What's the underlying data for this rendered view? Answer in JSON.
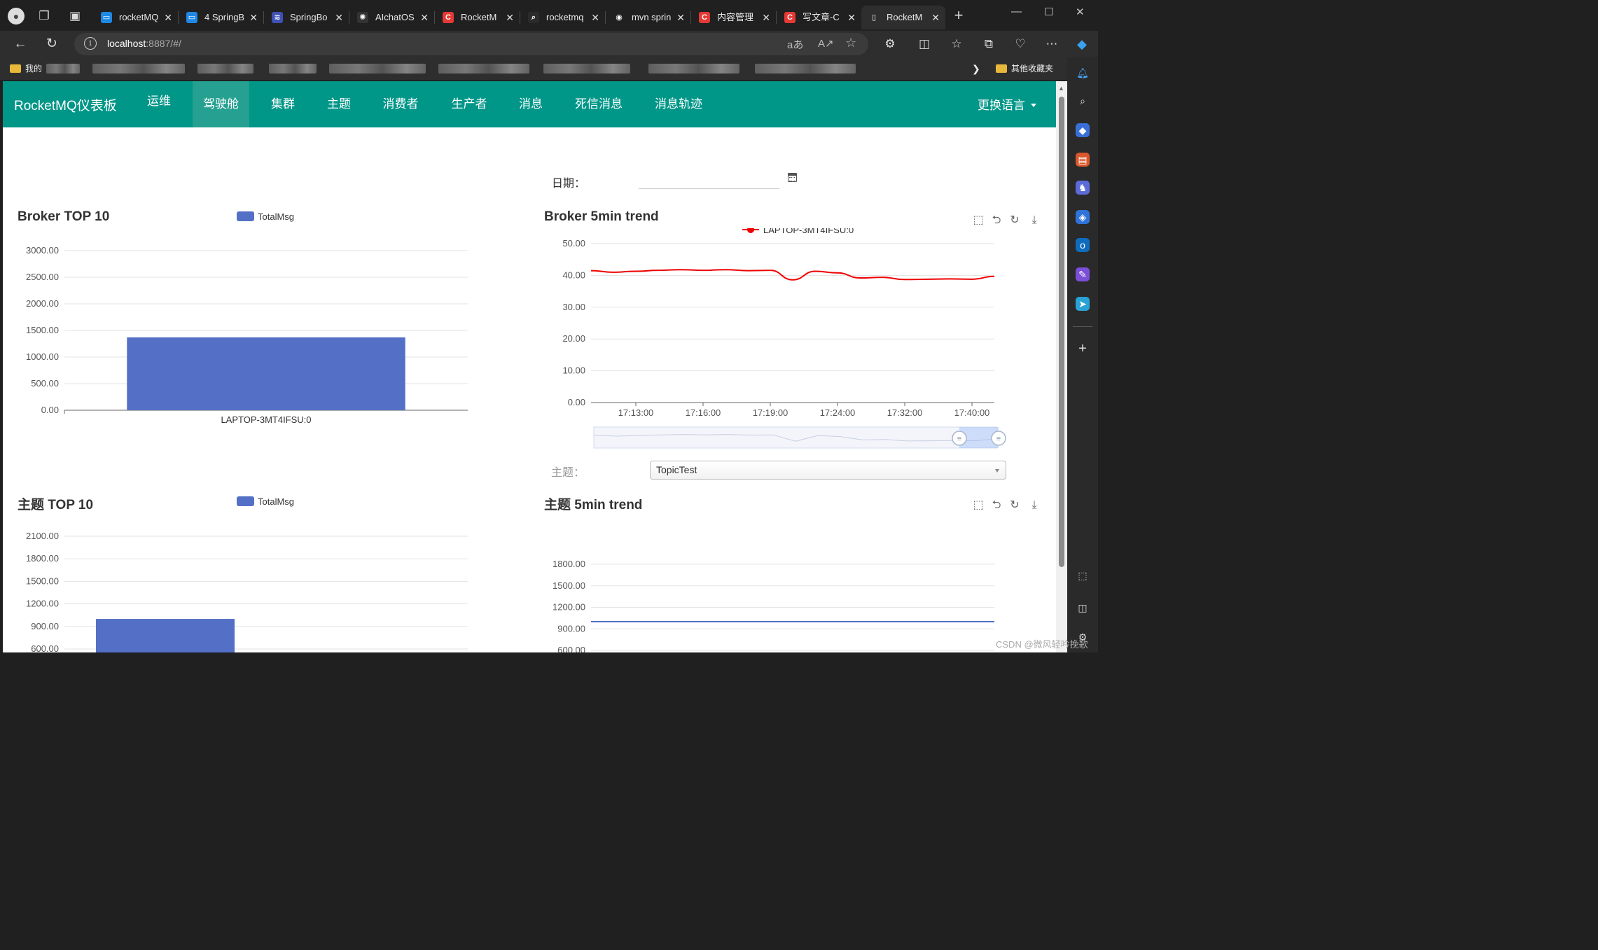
{
  "browser": {
    "tabs": [
      {
        "label": "rocketMQ",
        "favicon_color": "#1e88e5",
        "favicon": "▭"
      },
      {
        "label": "4 SpringB",
        "favicon_color": "#1e88e5",
        "favicon": "▭"
      },
      {
        "label": "SpringBo",
        "favicon_color": "#3f51b5",
        "favicon": "≋"
      },
      {
        "label": "AIchatOS",
        "favicon_color": "#333333",
        "favicon": "✺"
      },
      {
        "label": "RocketM",
        "favicon_color": "#e53935",
        "favicon": "C"
      },
      {
        "label": "rocketmq",
        "favicon_color": "#2b2b2b",
        "favicon": "⌕"
      },
      {
        "label": "mvn sprin",
        "favicon_color": "#202020",
        "favicon": "◉"
      },
      {
        "label": "内容管理",
        "favicon_color": "#e53935",
        "favicon": "C"
      },
      {
        "label": "写文章-C",
        "favicon_color": "#e53935",
        "favicon": "C"
      },
      {
        "label": "RocketM",
        "favicon_color": "#2e2e2e",
        "favicon": "▯"
      }
    ],
    "url_host": "localhost",
    "url_rest": ":8887/#/",
    "bookmarks": {
      "first": "我的",
      "last": "其他收藏夹"
    }
  },
  "app": {
    "brand": "RocketMQ仪表板",
    "nav": [
      "运维",
      "驾驶舱",
      "集群",
      "主题",
      "消费者",
      "生产者",
      "消息",
      "死信消息",
      "消息轨迹"
    ],
    "active_nav": "驾驶舱",
    "language": "更换语言",
    "date_label": "日期：",
    "date_value": "",
    "topic_label": "主题：",
    "topic_selected": "TopicTest",
    "colors": {
      "navbar": "#009688",
      "bar": "#5470c6",
      "line_red": "#ee0000"
    }
  },
  "watermark": "CSDN @微风轻吟挽歌",
  "chart_data": [
    {
      "type": "bar",
      "title": "Broker TOP 10",
      "legend": [
        "TotalMsg"
      ],
      "categories": [
        "LAPTOP-3MT4IFSU:0"
      ],
      "values": [
        1370
      ],
      "yticks": [
        "0.00",
        "500.00",
        "1000.00",
        "1500.00",
        "2000.00",
        "2500.00",
        "3000.00"
      ],
      "ylim": [
        0,
        3000
      ],
      "grid": true
    },
    {
      "type": "line",
      "title": "Broker 5min trend",
      "legend": [
        "LAPTOP-3MT4IFSU:0"
      ],
      "xticks": [
        "17:13:00",
        "17:16:00",
        "17:19:00",
        "17:24:00",
        "17:32:00",
        "17:40:00"
      ],
      "yticks": [
        "0.00",
        "10.00",
        "20.00",
        "30.00",
        "40.00",
        "50.00"
      ],
      "ylim": [
        0,
        50
      ],
      "series": [
        {
          "name": "LAPTOP-3MT4IFSU:0",
          "values": [
            41.5,
            41.0,
            41.3,
            41.6,
            41.8,
            41.6,
            41.8,
            41.5,
            41.6,
            38.6,
            41.3,
            40.8,
            39.2,
            39.4,
            38.7,
            38.8,
            38.9,
            38.8,
            39.7
          ]
        }
      ],
      "toolbox": [
        "zoom-icon",
        "zoom-reset-icon",
        "restore-icon",
        "save-image-icon"
      ],
      "datazoom": true,
      "grid": true
    },
    {
      "type": "bar",
      "title": "主题 TOP 10",
      "legend": [
        "TotalMsg"
      ],
      "categories": [
        ""
      ],
      "values": [
        1000
      ],
      "yticks": [
        "600.00",
        "900.00",
        "1200.00",
        "1500.00",
        "1800.00",
        "2100.00"
      ],
      "ylim": [
        600,
        2100
      ],
      "grid": true
    },
    {
      "type": "line",
      "title": "主题 5min trend",
      "yticks": [
        "600.00",
        "900.00",
        "1200.00",
        "1500.00",
        "1800.00"
      ],
      "ylim": [
        600,
        1800
      ],
      "series": [
        {
          "values": [
            1000,
            1000
          ]
        }
      ],
      "toolbox": [
        "zoom-icon",
        "zoom-reset-icon",
        "restore-icon",
        "save-image-icon"
      ],
      "grid": true
    }
  ]
}
